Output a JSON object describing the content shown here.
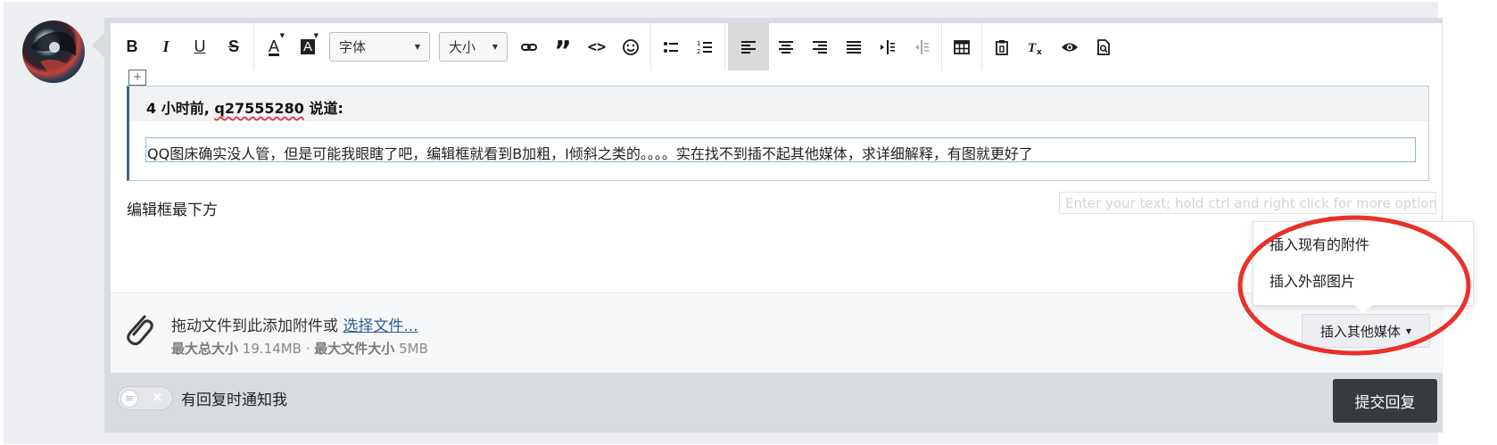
{
  "toolbar": {
    "bold": "B",
    "italic": "I",
    "underline": "U",
    "strike": "S",
    "text_color": "A",
    "bg_color": "A",
    "font_select": "字体",
    "size_select": "大小",
    "quote": "”",
    "code": "<>"
  },
  "quote": {
    "header_time": "4 小时前, ",
    "header_user": "q27555280",
    "header_suffix": " 说道:",
    "body_qq": "QQ",
    "body_rest": "图床确实没人管，但是可能我眼瞎了吧，编辑框就看到B加粗，I倾斜之类的。。。。实在找不到插不起其他媒体，求详细解释，有图就更好了"
  },
  "editor": {
    "placeholder_hint": "Enter your text; hold ctrl and right click for more options",
    "body_text": "编辑框最下方"
  },
  "attachments": {
    "drag_text": "拖动文件到此添加附件或 ",
    "choose_link": "选择文件...",
    "max_total_label": "最大总大小",
    "max_total_value": "19.14MB",
    "separator": " · ",
    "max_file_label": "最大文件大小",
    "max_file_value": "5MB",
    "media_button": "插入其他媒体"
  },
  "media_menu": {
    "items": [
      "插入现有的附件",
      "插入外部图片"
    ]
  },
  "footer": {
    "notify_label": "有回复时通知我",
    "submit_label": "提交回复"
  },
  "colors": {
    "annotation_circle": "#e8312a",
    "submit_bg": "#373b40",
    "link": "#2e5f96"
  }
}
